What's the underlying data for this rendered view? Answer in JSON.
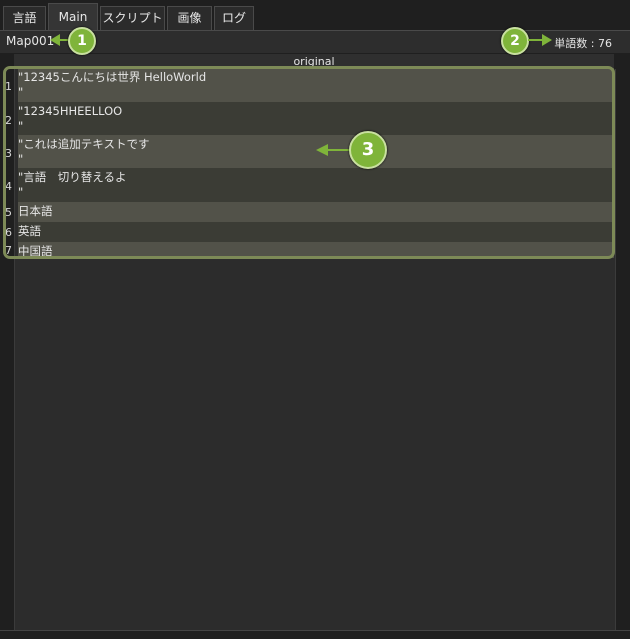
{
  "tabs": [
    {
      "label": "言語"
    },
    {
      "label": "Main"
    },
    {
      "label": "スクリプト"
    },
    {
      "label": "画像"
    },
    {
      "label": "ログ"
    }
  ],
  "toolbar": {
    "map_name": "Map001",
    "word_count": "単語数 : 76"
  },
  "table": {
    "column_header": "original",
    "rows": [
      {
        "num": "1",
        "text": "\"12345こんにちは世界 HelloWorld\n\""
      },
      {
        "num": "2",
        "text": "\"12345HHEELLOO\n\""
      },
      {
        "num": "3",
        "text": "\"これは追加テキストです\n\""
      },
      {
        "num": "4",
        "text": "\"言語　切り替えるよ\n\""
      },
      {
        "num": "5",
        "text": "日本語"
      },
      {
        "num": "6",
        "text": "英語"
      },
      {
        "num": "7",
        "text": "中国語"
      }
    ]
  },
  "annotations": [
    {
      "label": "1"
    },
    {
      "label": "2"
    },
    {
      "label": "3"
    }
  ],
  "colors": {
    "badge": "#7fb43a",
    "highlight_border": "#7d8a57"
  }
}
